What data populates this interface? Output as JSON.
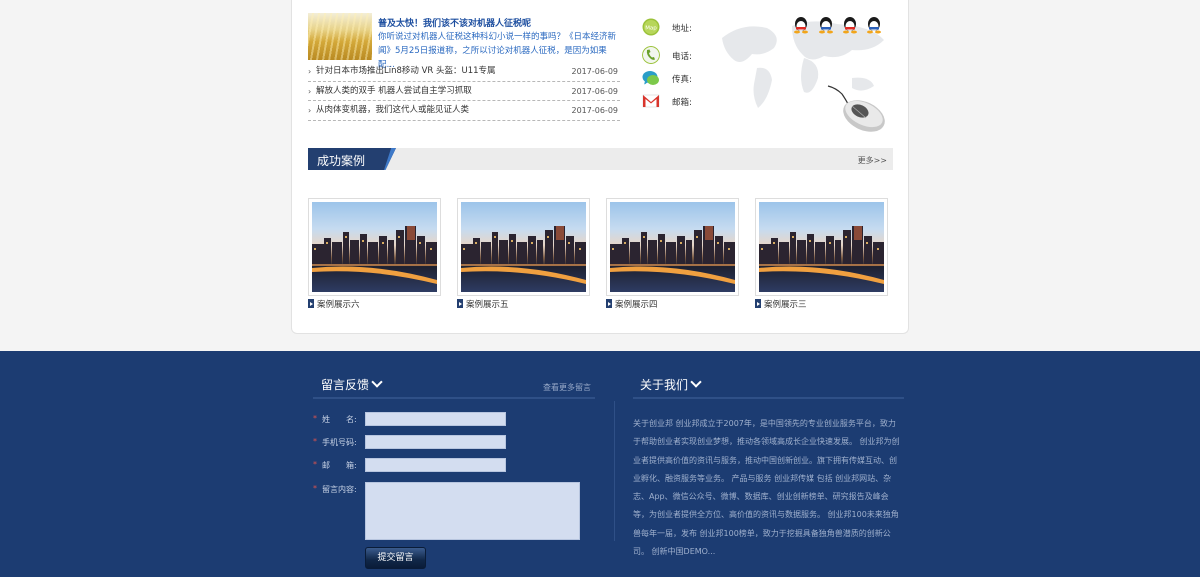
{
  "news": {
    "featured": {
      "title": "普及太快！我们该不该对机器人征税呢",
      "desc": "你听说过对机器人征税这种科幻小说一样的事吗？《日本经济新闻》5月25日报道称，之所以讨论对机器人征税，是因为如果配…"
    },
    "items": [
      {
        "title": "针对日本市场推出Lin8移动 VR 头盔：U11专属",
        "date": "2017-06-09"
      },
      {
        "title": "解放人类的双手 机器人尝试自主学习抓取",
        "date": "2017-06-09"
      },
      {
        "title": "从肉体变机器，我们这代人或能见证人类",
        "date": "2017-06-09"
      }
    ]
  },
  "contact": {
    "address_label": "地址:",
    "phone_label": "电话:",
    "fax_label": "传真:",
    "email_label": "邮箱:",
    "map_icon_text": "Map"
  },
  "cases": {
    "title": "成功案例",
    "more": "更多>>",
    "items": [
      {
        "caption": "案例展示六"
      },
      {
        "caption": "案例展示五"
      },
      {
        "caption": "案例展示四"
      },
      {
        "caption": "案例展示三"
      }
    ]
  },
  "feedback": {
    "title": "留言反馈",
    "more": "查看更多留言",
    "fields": {
      "name": "姓　　名:",
      "phone": "手机号码:",
      "email": "邮　　箱:",
      "content": "留言内容:"
    },
    "submit": "提交留言",
    "required_mark": "*"
  },
  "about": {
    "title": "关于我们",
    "text": "关于创业邦 创业邦成立于2007年，是中国领先的专业创业服务平台，致力于帮助创业者实现创业梦想，推动各领域高成长企业快速发展。 创业邦为创业者提供高价值的资讯与服务，推动中国创新创业。旗下拥有传媒互动、创业孵化、融资服务等业务。 产品与服务 创业邦传媒 包括 创业邦网站、杂志、App、微信公众号、微博、数据库、创业创新榜单、研究报告及峰会等，为创业者提供全方位、高价值的资讯与数据服务。 创业邦100未来独角兽每年一届，发布 创业邦100榜单，致力于挖掘具备独角兽潜质的创新公司。 创新中国DEMO..."
  },
  "colors": {
    "footer_bg": "#1c3c72",
    "accent_blue": "#233f70",
    "link_blue": "#1e4fa0"
  }
}
